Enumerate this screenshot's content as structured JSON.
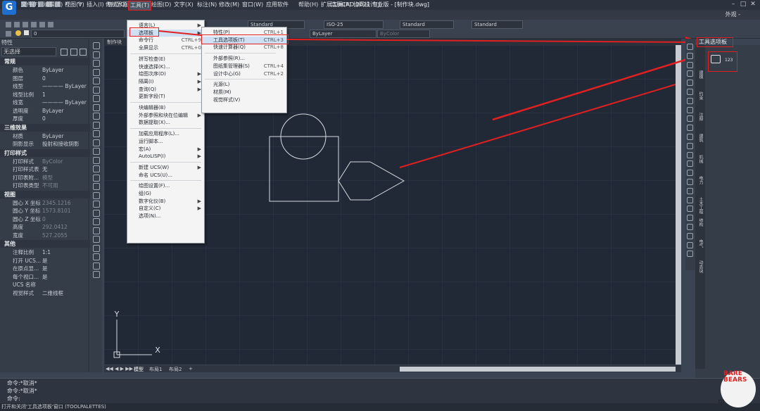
{
  "titlebar": {
    "workspace": "传统界面",
    "title": "浩辰CAD 2021 专业版 - [制作块.dwg]"
  },
  "menubar": {
    "items": [
      "文件(F)",
      "编辑(E)",
      "视图(V)",
      "插入(I)",
      "格式(O)",
      "工具(T)",
      "绘图(D)",
      "文字(X)",
      "标注(N)",
      "修改(M)",
      "窗口(W)",
      "应用软件",
      "帮助(H)",
      "扩展工具(P)",
      "协同设计(J)"
    ],
    "appearance": "外观 -"
  },
  "toolbar": {
    "text_style": "Standard",
    "dim_style": "ISO-25",
    "table_style": "Standard",
    "mleader_style": "Standard",
    "layer_value": "0",
    "linetype": "ByLayer",
    "lineweight": "ByColor"
  },
  "properties": {
    "title": "特性",
    "selection": "无选择",
    "sections": [
      {
        "name": "常规",
        "rows": [
          [
            "颜色",
            "ByLayer"
          ],
          [
            "图层",
            "0"
          ],
          [
            "线型",
            "———— ByLayer"
          ],
          [
            "线型比例",
            "1"
          ],
          [
            "线宽",
            "———— ByLayer"
          ],
          [
            "透明度",
            "ByLayer"
          ],
          [
            "厚度",
            "0"
          ]
        ]
      },
      {
        "name": "三维效果",
        "rows": [
          [
            "材质",
            "ByLayer"
          ],
          [
            "阴影显示",
            "投射和接收阴影"
          ]
        ]
      },
      {
        "name": "打印样式",
        "rows": [
          [
            "打印样式",
            "ByColor"
          ],
          [
            "打印样式表",
            "无"
          ],
          [
            "打印表附...",
            "模型"
          ],
          [
            "打印表类型",
            "不可用"
          ]
        ]
      },
      {
        "name": "视图",
        "rows": [
          [
            "圆心 X 坐标",
            "2345.1216"
          ],
          [
            "圆心 Y 坐标",
            "1573.8101"
          ],
          [
            "圆心 Z 坐标",
            "0"
          ],
          [
            "高度",
            "292.0412"
          ],
          [
            "宽度",
            "527.2055"
          ]
        ]
      },
      {
        "name": "其他",
        "rows": [
          [
            "注释比例",
            "1:1"
          ],
          [
            "打开 UCS...",
            "是"
          ],
          [
            "在原点显...",
            "是"
          ],
          [
            "每个视口...",
            "是"
          ],
          [
            "UCS 名称",
            ""
          ],
          [
            "视觉样式",
            "二维线框"
          ]
        ]
      }
    ]
  },
  "canvas": {
    "doc_tab": "制作块",
    "layout_tabs": [
      "模型",
      "布局1",
      "布局2",
      "+"
    ],
    "axis_y": "Y",
    "axis_x": "X"
  },
  "tools_menu": [
    {
      "label": "语言(L)",
      "arrow": true
    },
    {
      "label": "选项板",
      "arrow": true,
      "highlight": true
    },
    {
      "label": "命令行",
      "shortcut": "CTRL+9"
    },
    {
      "label": "全屏显示",
      "shortcut": "CTRL+0"
    },
    {
      "sep": true
    },
    {
      "label": "拼写检查(E)"
    },
    {
      "label": "快速选择(K)..."
    },
    {
      "label": "绘图次序(D)",
      "arrow": true
    },
    {
      "label": "隔离(I)",
      "arrow": true
    },
    {
      "label": "查询(Q)",
      "arrow": true
    },
    {
      "label": "更新字段(T)"
    },
    {
      "sep": true
    },
    {
      "label": "块编辑器(B)"
    },
    {
      "label": "外部参照和块在位编辑",
      "arrow": true
    },
    {
      "label": "数据提取(X)..."
    },
    {
      "sep": true
    },
    {
      "label": "加载应用程序(L)..."
    },
    {
      "label": "运行脚本..."
    },
    {
      "label": "宏(A)",
      "arrow": true
    },
    {
      "label": "AutoLISP(I)",
      "arrow": true
    },
    {
      "sep": true
    },
    {
      "label": "新建 UCS(W)",
      "arrow": true
    },
    {
      "label": "命名 UCS(U)..."
    },
    {
      "sep": true
    },
    {
      "label": "绘图设置(F)..."
    },
    {
      "label": "组(G)"
    },
    {
      "label": "数字化仪(B)",
      "arrow": true
    },
    {
      "label": "自定义(C)",
      "arrow": true
    },
    {
      "label": "选项(N)..."
    }
  ],
  "palette_menu": [
    {
      "label": "特性(P)",
      "shortcut": "CTRL+1"
    },
    {
      "label": "工具选项板(T)",
      "shortcut": "CTRL+3",
      "highlight": true
    },
    {
      "label": "快速计算器(Q)",
      "shortcut": "CTRL+8"
    },
    {
      "sep": true
    },
    {
      "label": "外部参照(R)..."
    },
    {
      "label": "图纸集管理器(S)",
      "shortcut": "CTRL+4"
    },
    {
      "label": "设计中心(G)",
      "shortcut": "CTRL+2"
    },
    {
      "sep": true
    },
    {
      "label": "光源(L)"
    },
    {
      "label": "材质(M)"
    },
    {
      "label": "视觉样式(V)"
    }
  ],
  "palette": {
    "title": "工具选项板",
    "vertical_tabs": [
      "建模",
      "约束",
      "注释",
      "建筑",
      "机械",
      "电力",
      "土木工程",
      "结构",
      "电气",
      "动态块"
    ],
    "item_label": "123"
  },
  "command": {
    "lines": [
      "命令:*取消*",
      "命令:*取消*",
      "命令:"
    ],
    "status": "打开和关闭'工具选项板'窗口 (TOOLPALETTES)"
  },
  "watermark": {
    "text": "BARE BEARS",
    "sub": "中"
  },
  "colors": {
    "accent_red": "#e02020",
    "canvas_bg": "#212936",
    "panel_bg": "#353d49"
  }
}
